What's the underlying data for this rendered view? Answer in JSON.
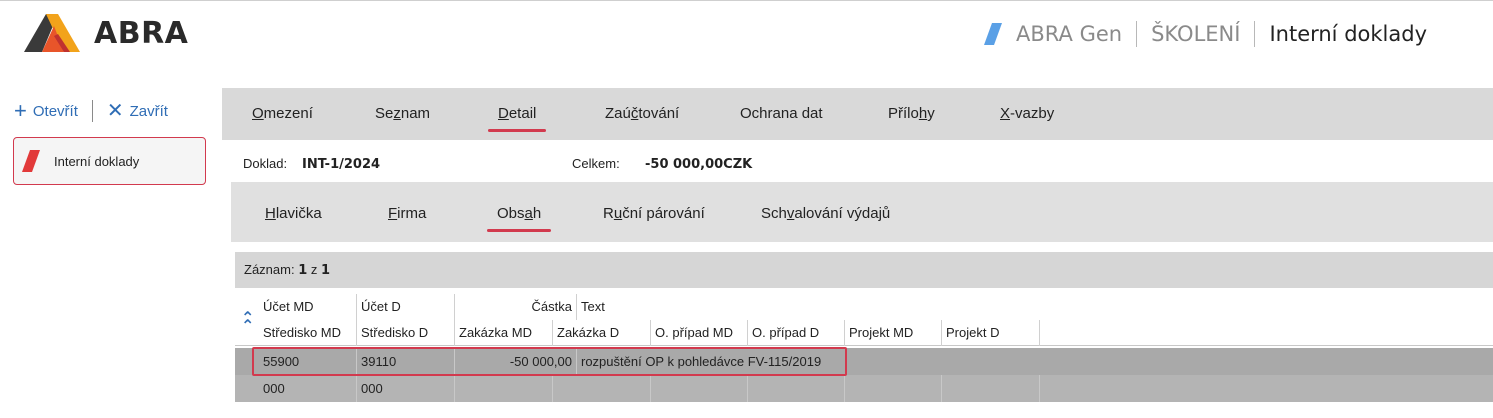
{
  "header": {
    "logo_text": "ABRA",
    "app_name": "ABRA Gen",
    "company": "ŠKOLENÍ",
    "module": "Interní doklady"
  },
  "left_panel": {
    "open_label": "Otevřít",
    "close_label": "Zavřít",
    "item_label": "Interní doklady"
  },
  "tabs_main": [
    {
      "pre": "",
      "ul": "O",
      "post": "mezení"
    },
    {
      "pre": "Se",
      "ul": "z",
      "post": "nam"
    },
    {
      "pre": "",
      "ul": "D",
      "post": "etail"
    },
    {
      "pre": "Zaú",
      "ul": "č",
      "post": "tování"
    },
    {
      "pre": "Ochrana dat",
      "ul": "",
      "post": ""
    },
    {
      "pre": "Přílo",
      "ul": "h",
      "post": "y"
    },
    {
      "pre": "",
      "ul": "X",
      "post": "-vazby"
    }
  ],
  "info": {
    "doklad_label": "Doklad:",
    "doklad_value": "INT-1/2024",
    "celkem_label": "Celkem:",
    "celkem_value": "-50 000,00CZK"
  },
  "tabs_sub": [
    {
      "pre": "",
      "ul": "H",
      "post": "lavička"
    },
    {
      "pre": "",
      "ul": "F",
      "post": "irma"
    },
    {
      "pre": "Obs",
      "ul": "a",
      "post": "h"
    },
    {
      "pre": "R",
      "ul": "u",
      "post": "ční párování"
    },
    {
      "pre": "Sch",
      "ul": "v",
      "post": "alování výdajů"
    }
  ],
  "record": {
    "label": "Záznam:",
    "current": "1",
    "of": "z",
    "total": "1"
  },
  "grid": {
    "header1": [
      "Účet MD",
      "Účet D",
      "Částka",
      "Text"
    ],
    "header2": [
      "Středisko MD",
      "Středisko D",
      "Zakázka MD",
      "Zakázka D",
      "O. případ MD",
      "O. případ D",
      "Projekt MD",
      "Projekt D"
    ],
    "row1": [
      "55900",
      "39110",
      "-50 000,00",
      "rozpuštění OP k pohledávce FV-115/2019"
    ],
    "row2": [
      "000",
      "000"
    ]
  },
  "colors": {
    "accent": "#d23a4e",
    "link": "#2f6db5"
  }
}
